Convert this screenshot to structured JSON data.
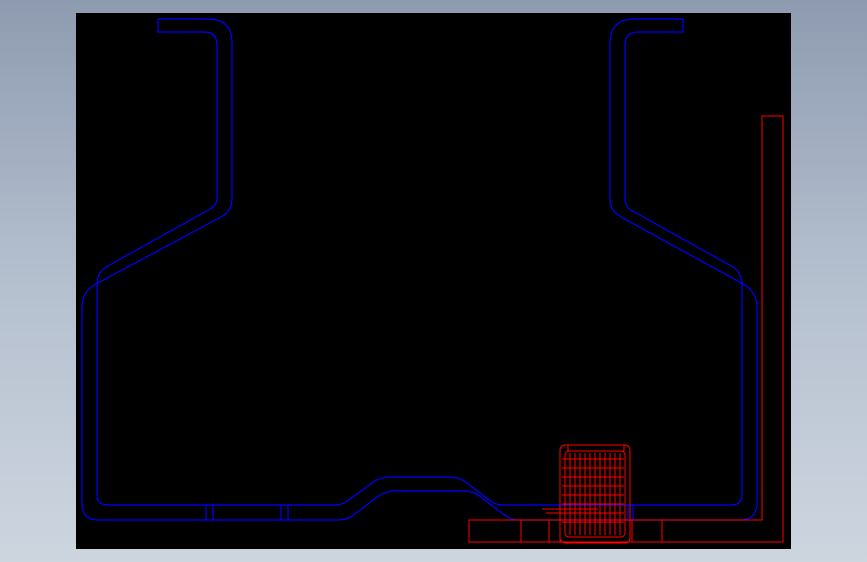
{
  "viewport": {
    "background_color": "#000000",
    "window_background": "#a5b1c2"
  },
  "drawing": {
    "profile_color": "#0000ff",
    "fixture_color": "#ff0000",
    "profile_shape": "symmetric channel profile with flared flanges and raised center bead",
    "fixture_shape": "L-shaped support bracket with clamp assembly at lower right"
  }
}
